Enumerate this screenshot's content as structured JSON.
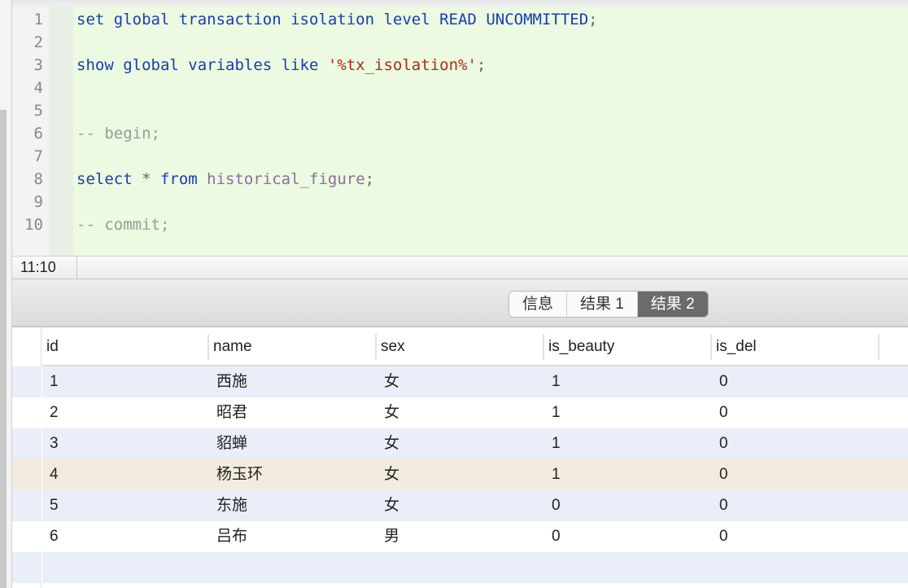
{
  "editor": {
    "lines": [
      {
        "n": "1",
        "parts": [
          {
            "t": "set global transaction isolation level READ UNCOMMITTED",
            "c": ""
          },
          {
            "t": ";",
            "c": "op"
          }
        ]
      },
      {
        "n": "2",
        "parts": []
      },
      {
        "n": "3",
        "parts": [
          {
            "t": "show global variables like ",
            "c": ""
          },
          {
            "t": "'%tx_isolation%'",
            "c": "str"
          },
          {
            "t": ";",
            "c": "op"
          }
        ]
      },
      {
        "n": "4",
        "parts": []
      },
      {
        "n": "5",
        "parts": []
      },
      {
        "n": "6",
        "parts": [
          {
            "t": "-- begin;",
            "c": "cmt"
          }
        ]
      },
      {
        "n": "7",
        "parts": []
      },
      {
        "n": "8",
        "parts": [
          {
            "t": "select ",
            "c": ""
          },
          {
            "t": "* ",
            "c": "op"
          },
          {
            "t": "from ",
            "c": ""
          },
          {
            "t": "historical_figure",
            "c": "id"
          },
          {
            "t": ";",
            "c": "op"
          }
        ]
      },
      {
        "n": "9",
        "parts": []
      },
      {
        "n": "10",
        "parts": [
          {
            "t": "-- commit;",
            "c": "cmt"
          }
        ]
      }
    ]
  },
  "status": {
    "cursor_position": "11:10"
  },
  "tabs": [
    {
      "label": "信息",
      "active": false
    },
    {
      "label": "结果 1",
      "active": false
    },
    {
      "label": "结果 2",
      "active": true
    }
  ],
  "table": {
    "columns": [
      "id",
      "name",
      "sex",
      "is_beauty",
      "is_del"
    ],
    "rows": [
      [
        "1",
        "西施",
        "女",
        "1",
        "0"
      ],
      [
        "2",
        "昭君",
        "女",
        "1",
        "0"
      ],
      [
        "3",
        "貂蝉",
        "女",
        "1",
        "0"
      ],
      [
        "4",
        "杨玉环",
        "女",
        "1",
        "0"
      ],
      [
        "5",
        "东施",
        "女",
        "0",
        "0"
      ],
      [
        "6",
        "吕布",
        "男",
        "0",
        "0"
      ]
    ],
    "selected_row": 3
  },
  "colors": {
    "editor_bg": "#ebfae0",
    "keyword": "#1a3cb4",
    "string": "#b02a1a",
    "comment": "#999999",
    "row_alt": "#e9eef9",
    "row_selected": "#f3ecde",
    "tab_active": "#6b6b6b"
  }
}
